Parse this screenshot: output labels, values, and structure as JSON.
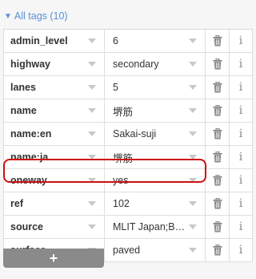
{
  "header": {
    "toggle": "▼",
    "title": "All tags (10)"
  },
  "tags": [
    {
      "key": "admin_level",
      "value": "6"
    },
    {
      "key": "highway",
      "value": "secondary"
    },
    {
      "key": "lanes",
      "value": "5"
    },
    {
      "key": "name",
      "value": "堺筋"
    },
    {
      "key": "name:en",
      "value": "Sakai-suji"
    },
    {
      "key": "name:ja",
      "value": "堺筋"
    },
    {
      "key": "oneway",
      "value": "yes"
    },
    {
      "key": "ref",
      "value": "102"
    },
    {
      "key": "source",
      "value": "MLIT Japan;Bing, S ..."
    },
    {
      "key": "surface",
      "value": "paved"
    }
  ],
  "row_icons": {
    "delete": "trash-icon",
    "info": "info-icon",
    "info_glyph": "i"
  },
  "highlighted_key": "oneway",
  "add_button": {
    "label": "+"
  },
  "colors": {
    "accent": "#5a8fd6",
    "highlight": "#d01010",
    "add_button_bg": "#8a8a8a"
  }
}
